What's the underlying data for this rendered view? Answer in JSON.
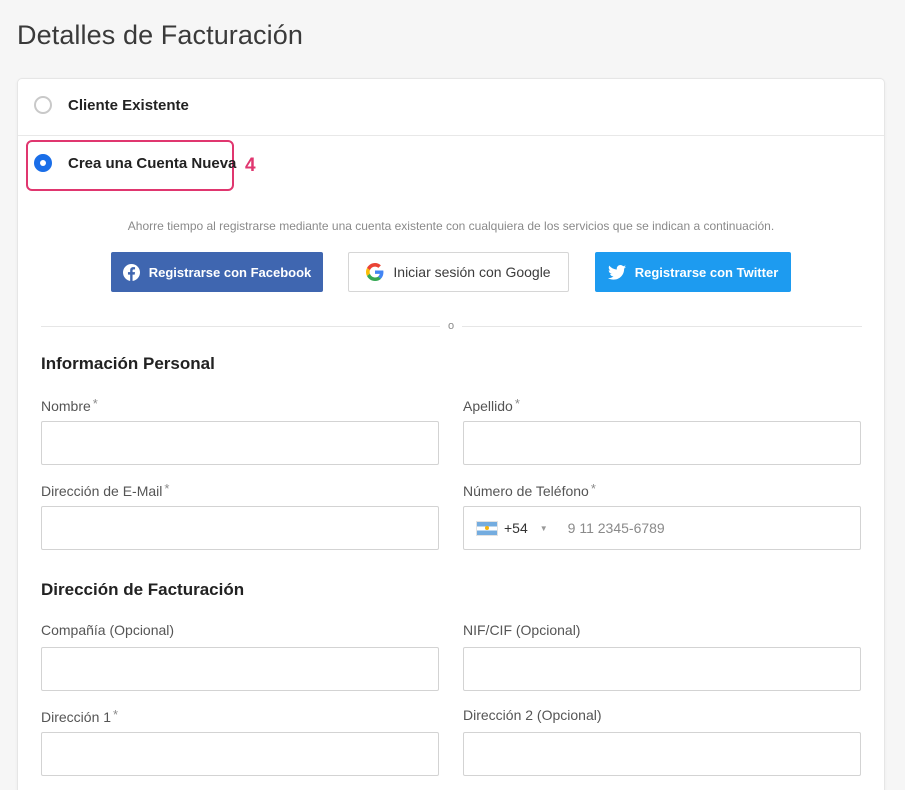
{
  "page_title": "Detalles de Facturación",
  "account_options": {
    "existing_label": "Cliente Existente",
    "new_label": "Crea una Cuenta Nueva",
    "step_number": "4"
  },
  "social": {
    "intro": "Ahorre tiempo al registrarse mediante una cuenta existente con cualquiera de los servicios que se indican a continuación.",
    "facebook_label": "Registrarse con Facebook",
    "google_label": "Iniciar sesión con Google",
    "twitter_label": "Registrarse con Twitter",
    "or_text": "o"
  },
  "personal": {
    "title": "Información Personal",
    "first_name_label": "Nombre",
    "last_name_label": "Apellido",
    "email_label": "Dirección de E-Mail",
    "phone_label": "Número de Teléfono",
    "phone_dial_code": "+54",
    "phone_placeholder": "9 11 2345-6789",
    "required_mark": "*"
  },
  "billing": {
    "title": "Dirección de Facturación",
    "company_label": "Compañía (Opcional)",
    "tax_id_label": "NIF/CIF (Opcional)",
    "address1_label": "Dirección 1",
    "address2_label": "Dirección 2 (Opcional)"
  },
  "colors": {
    "accent_blue": "#1a6ee8",
    "highlight_pink": "#e0366f",
    "facebook": "#3f66b0",
    "twitter": "#1d9bf0"
  }
}
